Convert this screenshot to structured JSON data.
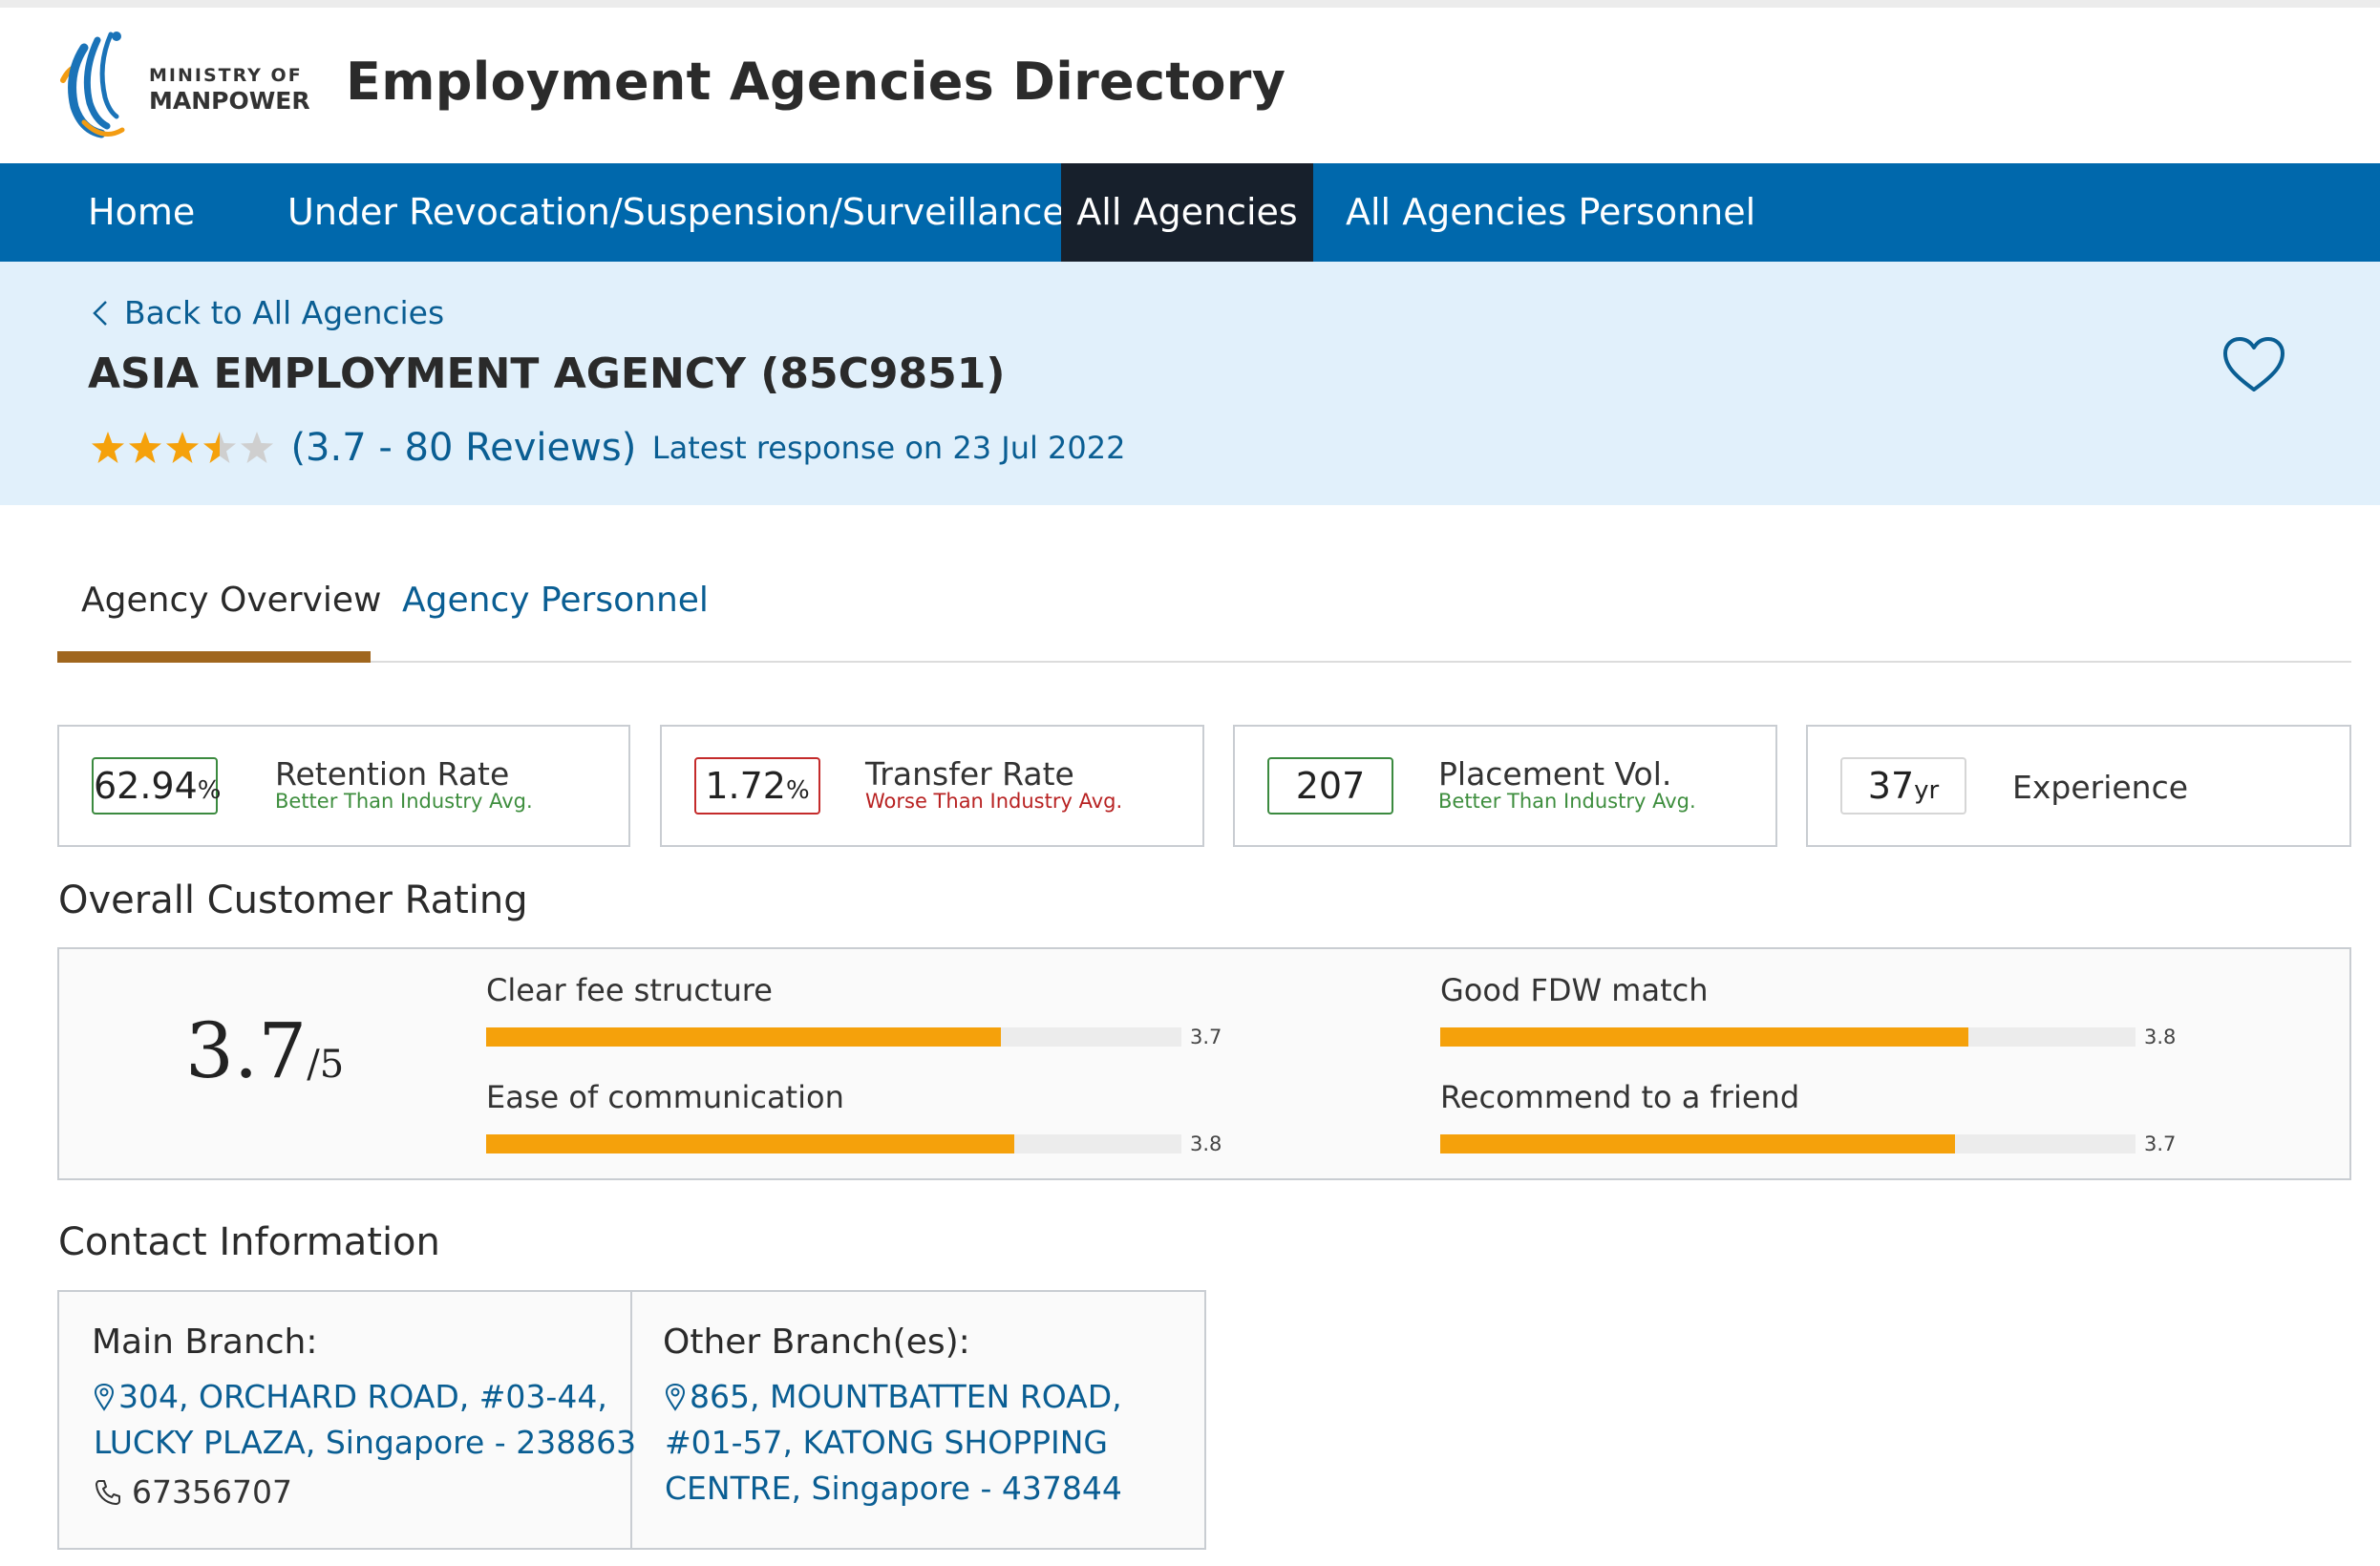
{
  "header": {
    "logo": {
      "line1": "MINISTRY OF",
      "line2": "MANPOWER"
    },
    "site_title": "Employment Agencies Directory"
  },
  "nav": {
    "items": [
      {
        "label": "Home",
        "active": false
      },
      {
        "label": "Under Revocation/Suspension/Surveillance",
        "active": false
      },
      {
        "label": "All Agencies",
        "active": true
      },
      {
        "label": "All Agencies Personnel",
        "active": false
      }
    ]
  },
  "agency": {
    "back_label": "Back to All Agencies",
    "name": "ASIA EMPLOYMENT AGENCY (85C9851)",
    "star_rating": 3.7,
    "reviews_label": "(3.7 - 80 Reviews)",
    "latest_response": "Latest response on 23 Jul 2022"
  },
  "tabs": [
    {
      "label": "Agency Overview",
      "active": true
    },
    {
      "label": "Agency Personnel",
      "active": false
    }
  ],
  "stats": [
    {
      "value": "62.94",
      "unit": "%",
      "label": "Retention Rate",
      "sub": "Better Than Industry Avg.",
      "tone": "good"
    },
    {
      "value": "1.72",
      "unit": "%",
      "label": "Transfer Rate",
      "sub": "Worse Than Industry Avg.",
      "tone": "bad"
    },
    {
      "value": "207",
      "unit": "",
      "label": "Placement Vol.",
      "sub": "Better Than Industry Avg.",
      "tone": "good"
    },
    {
      "value": "37",
      "unit": "yr",
      "label": "Experience",
      "sub": "",
      "tone": "neutral"
    }
  ],
  "rating": {
    "section_title": "Overall Customer Rating",
    "overall": "3.7",
    "out_of": "/5",
    "metrics": [
      {
        "label": "Clear fee structure",
        "value": "3.7",
        "fill": 0.74
      },
      {
        "label": "Good FDW match",
        "value": "3.8",
        "fill": 0.76
      },
      {
        "label": "Ease of communication",
        "value": "3.8",
        "fill": 0.76
      },
      {
        "label": "Recommend to a friend",
        "value": "3.7",
        "fill": 0.74
      }
    ]
  },
  "contact": {
    "section_title": "Contact Information",
    "main": {
      "title": "Main Branch:",
      "address_lines": [
        "304, ORCHARD ROAD, #03-44,",
        "LUCKY PLAZA, Singapore - 238863"
      ],
      "phone": "67356707"
    },
    "other": {
      "title": "Other Branch(es):",
      "address_lines": [
        "865, MOUNTBATTEN ROAD,",
        "#01-57, KATONG SHOPPING",
        "CENTRE, Singapore - 437844"
      ]
    }
  },
  "colors": {
    "nav_bg": "#0068ac",
    "nav_active_bg": "#17202c",
    "banner_bg": "#e1f0fb",
    "link": "#0a5e93",
    "star": "#f5a10b",
    "bar_fill": "#f5a10b",
    "tab_underline": "#a0661e",
    "good": "#3e8e3e",
    "bad": "#b82222"
  }
}
